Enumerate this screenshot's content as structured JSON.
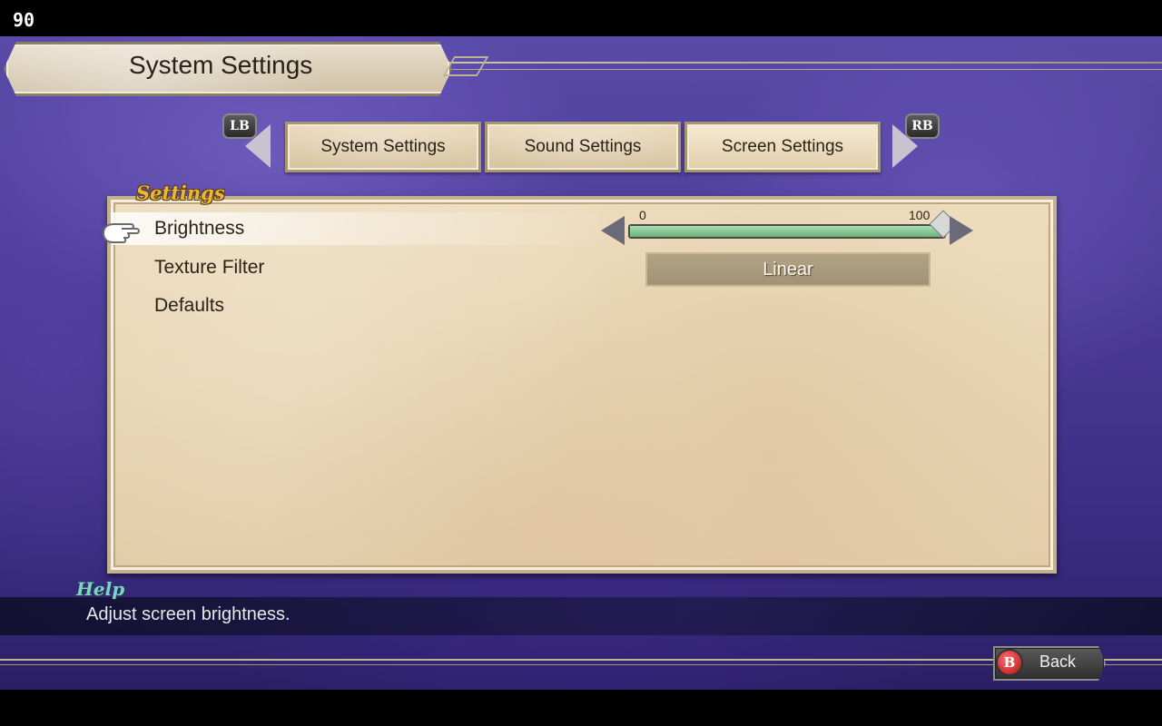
{
  "overlay": {
    "fps": "90"
  },
  "header": {
    "title": "System Settings"
  },
  "tabs": {
    "prev_button": "LB",
    "next_button": "RB",
    "items": [
      {
        "label": "System Settings"
      },
      {
        "label": "Sound Settings"
      },
      {
        "label": "Screen Settings",
        "active": true
      }
    ]
  },
  "panel": {
    "label": "Settings",
    "rows": [
      {
        "label": "Brightness",
        "selected": true
      },
      {
        "label": "Texture Filter"
      },
      {
        "label": "Defaults"
      }
    ]
  },
  "brightness_slider": {
    "min_label": "0",
    "max_label": "100",
    "value": 100
  },
  "texture_filter": {
    "value": "Linear"
  },
  "help": {
    "label": "Help",
    "text": "Adjust screen brightness."
  },
  "footer": {
    "button_key": "B",
    "back_label": "Back"
  },
  "colors": {
    "accent_gold": "#e9b73a",
    "help_teal": "#7cd4c2",
    "slider_green": "#8fd09e",
    "background_purple": "#4b3b98"
  }
}
